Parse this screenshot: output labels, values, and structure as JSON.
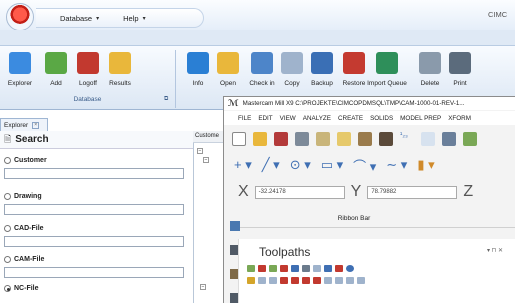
{
  "titlebar": {
    "quick_access": [
      "Database",
      "Help"
    ],
    "app_title": "CIMC"
  },
  "ribbon": {
    "buttons": [
      {
        "label": "Explorer",
        "icon": "explorer-icon",
        "color": "#3b8be0"
      },
      {
        "label": "Add",
        "icon": "add-icon",
        "color": "#5aa845"
      },
      {
        "label": "Logoff",
        "icon": "logoff-icon",
        "color": "#c2392f"
      },
      {
        "label": "Results",
        "icon": "results-icon",
        "color": "#e9b73b"
      },
      {
        "label": "Info",
        "icon": "info-icon",
        "color": "#2a7fd4"
      },
      {
        "label": "Open",
        "icon": "open-folder-icon",
        "color": "#e9b73b"
      },
      {
        "label": "Check in",
        "icon": "check-in-icon",
        "color": "#4d85c9"
      },
      {
        "label": "Copy",
        "icon": "copy-icon",
        "color": "#9fb3cc"
      },
      {
        "label": "Backup",
        "icon": "backup-icon",
        "color": "#3a6fb5"
      },
      {
        "label": "Restore",
        "icon": "restore-icon",
        "color": "#c43a30"
      },
      {
        "label": "Import Queue",
        "icon": "import-queue-icon",
        "color": "#2e8f5a"
      },
      {
        "label": "Delete",
        "icon": "delete-icon",
        "color": "#8a9aab"
      },
      {
        "label": "Print",
        "icon": "print-icon",
        "color": "#5b6b7c"
      }
    ],
    "group_label": "Database"
  },
  "explorer": {
    "tab_label": "Explorer",
    "search_title": "Search",
    "options": [
      {
        "label": "Customer",
        "selected": false
      },
      {
        "label": "Drawing",
        "selected": false
      },
      {
        "label": "CAD-File",
        "selected": false
      },
      {
        "label": "CAM-File",
        "selected": false
      },
      {
        "label": "NC-File",
        "selected": true
      }
    ],
    "tree_header": "Custome"
  },
  "mastercam": {
    "title": "Mastercam Mill X9  C:\\PROJEKTE\\CIMCOPDMSQL\\TMP\\CAM-1000-01-REV-1...",
    "menu": [
      "FILE",
      "EDIT",
      "VIEW",
      "ANALYZE",
      "CREATE",
      "SOLIDS",
      "MODEL PREP",
      "XFORM"
    ],
    "coords": {
      "x_label": "X",
      "x_value": "-32.24178",
      "y_label": "Y",
      "y_value": "78.79882",
      "z_label": "Z"
    },
    "ribbon_bar_label": "Ribbon Bar",
    "toolpaths_title": "Toolpaths",
    "toolpaths_controls": "▾ ⊓ ✕"
  }
}
